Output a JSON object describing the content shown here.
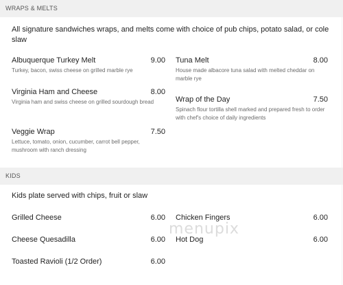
{
  "wraps": {
    "heading": "WRAPS & MELTS",
    "note": "All signature sandwiches wraps, and melts come with choice of pub chips, potato salad, or cole slaw",
    "items": [
      {
        "name": "Albuquerque Turkey Melt",
        "price": "9.00",
        "desc": "Turkey, bacon, swiss cheese on grilled marble rye"
      },
      {
        "name": "Tuna Melt",
        "price": "8.00",
        "desc": "House made albacore tuna salad with melted cheddar on marble rye"
      },
      {
        "name": "Virginia Ham and Cheese",
        "price": "8.00",
        "desc": "Virginia ham and swiss cheese on grilled sourdough bread"
      },
      {
        "name": "Wrap of the Day",
        "price": "7.50",
        "desc": "Spinach flour tortilla shell marked and prepared fresh to order with chef's choice of daily ingredients"
      },
      {
        "name": "Veggie Wrap",
        "price": "7.50",
        "desc": "Lettuce, tomato, onion, cucumber, carrot bell pepper, mushroom with ranch dressing"
      }
    ]
  },
  "kids": {
    "heading": "KIDS",
    "note": "Kids plate served with chips, fruit or slaw",
    "items": [
      {
        "name": "Grilled Cheese",
        "price": "6.00"
      },
      {
        "name": "Chicken Fingers",
        "price": "6.00"
      },
      {
        "name": "Cheese Quesadilla",
        "price": "6.00"
      },
      {
        "name": "Hot Dog",
        "price": "6.00"
      },
      {
        "name": "Toasted Ravioli (1/2 Order)",
        "price": "6.00"
      }
    ]
  },
  "watermark": "menupix"
}
